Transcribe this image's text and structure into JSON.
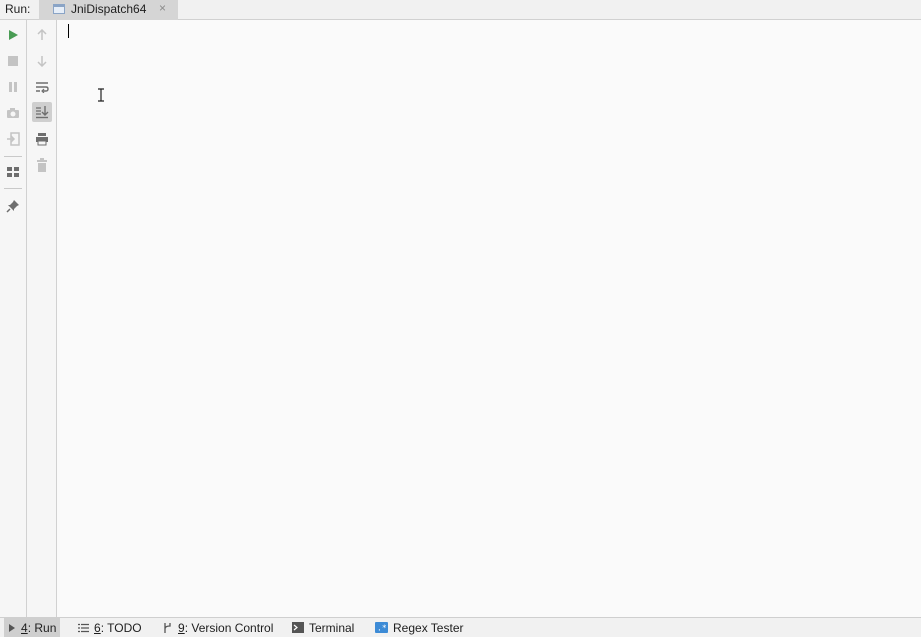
{
  "header": {
    "run_label": "Run:",
    "tab": {
      "title": "JniDispatch64",
      "close": "×"
    }
  },
  "toolbar_left": [
    {
      "name": "rerun-icon",
      "tooltip": ""
    },
    {
      "name": "stop-icon"
    },
    {
      "name": "pause-icon"
    },
    {
      "name": "camera-icon"
    },
    {
      "name": "exit-icon"
    },
    {
      "name": "layout-icon"
    },
    {
      "name": "pin-icon"
    }
  ],
  "toolbar_right": [
    {
      "name": "arrow-up-icon"
    },
    {
      "name": "arrow-down-icon"
    },
    {
      "name": "soft-wrap-icon"
    },
    {
      "name": "scroll-to-end-icon",
      "active": true
    },
    {
      "name": "print-icon"
    },
    {
      "name": "trash-icon"
    }
  ],
  "console": {
    "text": ""
  },
  "bottom_tabs": [
    {
      "mnemonic": "4",
      "label": ": Run",
      "icon": "run-icon",
      "active": true
    },
    {
      "mnemonic": "6",
      "label": ": TODO",
      "icon": "todo-icon"
    },
    {
      "mnemonic": "9",
      "label": ": Version Control",
      "icon": "vcs-icon"
    },
    {
      "mnemonic": "",
      "label": "Terminal",
      "icon": "terminal-icon"
    },
    {
      "mnemonic": "",
      "label": "Regex Tester",
      "icon": "regex-icon"
    }
  ],
  "colors": {
    "run_green": "#499c54",
    "icon_gray": "#6e6e6e",
    "icon_disabled": "#c4c4c4",
    "accent_blue": "#3d8bd6"
  }
}
